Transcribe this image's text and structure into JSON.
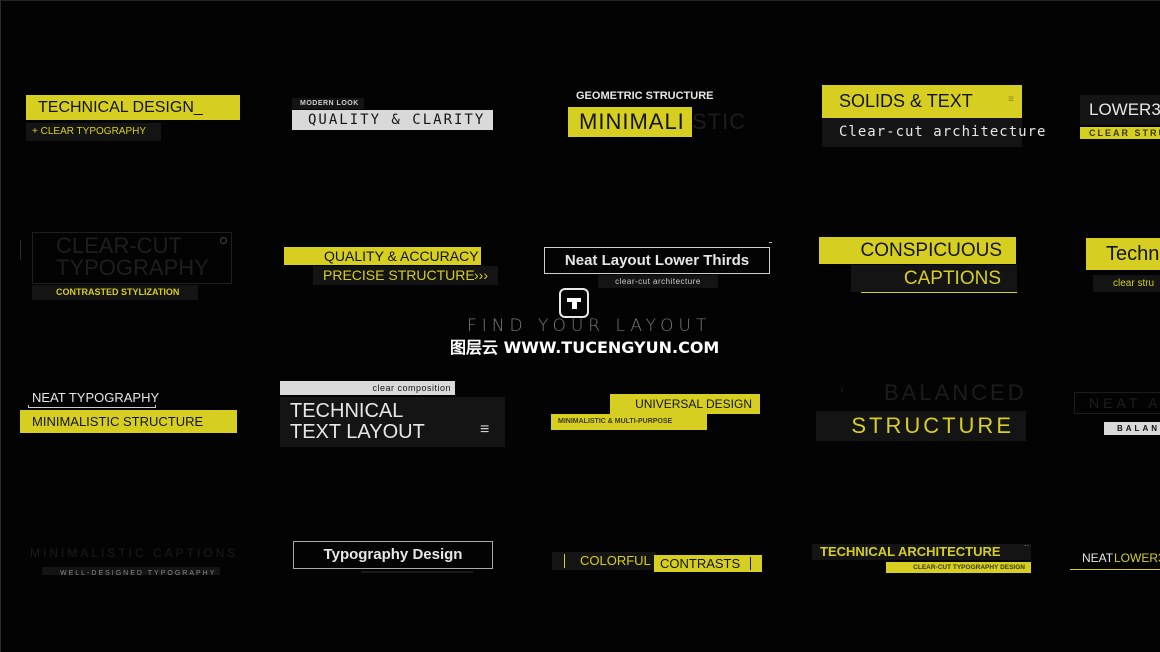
{
  "colors": {
    "accent": "#d6cf22",
    "background": "#030303",
    "panel": "#141414",
    "light": "#d9d9d9"
  },
  "center": {
    "logo_icon": "T",
    "tagline": "FIND YOUR LAYOUT",
    "watermark": "图层云 WWW.TUCENGYUN.COM"
  },
  "row1": {
    "t1": {
      "title": "TECHNICAL DESIGN_",
      "sub": "+ CLEAR TYPOGRAPHY"
    },
    "t2": {
      "kicker": "MODERN LOOK",
      "title": "QUALITY & CLARITY"
    },
    "t3": {
      "kicker": "GEOMETRIC STRUCTURE",
      "title_a": "MINIMALI",
      "title_b": "STIC"
    },
    "t4": {
      "title": "SOLIDS & TEXT",
      "sub": "Clear-cut architecture"
    },
    "t5": {
      "title": "LOWER3",
      "sub": "CLEAR STRU"
    }
  },
  "row2": {
    "t1": {
      "line1": "CLEAR-CUT",
      "line2": "TYPOGRAPHY",
      "sub": "CONTRASTED STYLIZATION"
    },
    "t2": {
      "title": "QUALITY & ACCURACY",
      "sub": "PRECISE STRUCTURE",
      "arrows": "›››"
    },
    "t3": {
      "title": "Neat Layout Lower Thirds",
      "sub": "clear-cut architecture"
    },
    "t4": {
      "title": "CONSPICUOUS",
      "sub": "CAPTIONS"
    },
    "t5": {
      "title": "Techn",
      "sub": "clear stru"
    }
  },
  "row3": {
    "t1": {
      "kicker": "NEAT TYPOGRAPHY",
      "title": "MINIMALISTIC STRUCTURE"
    },
    "t2": {
      "kicker": "clear composition",
      "line1": "TECHNICAL",
      "line2": "TEXT LAYOUT",
      "menu_icon": "≡"
    },
    "t3": {
      "title": "UNIVERSAL DESIGN",
      "sub": "MINIMALISTIC & MULTI-PURPOSE"
    },
    "t4": {
      "title": "BALANCED",
      "sub": "STRUCTURE",
      "marker": "›"
    },
    "t5": {
      "title": "NEAT AR",
      "sub": "BALANC"
    }
  },
  "row4": {
    "t1": {
      "title": "MINIMALISTIC CAPTIONS",
      "sub": "WELL-DESIGNED TYPOGRAPHY"
    },
    "t2": {
      "title": "Typography Design"
    },
    "t3": {
      "word1": "COLORFUL",
      "word2": "CONTRASTS"
    },
    "t4": {
      "title": "TECHNICAL ARCHITECTURE",
      "sub": "CLEAR-CUT TYPOGRAPHY DESIGN",
      "dots": "··"
    },
    "t5": {
      "word1": "NEAT",
      "word2": "LOWER3"
    }
  }
}
